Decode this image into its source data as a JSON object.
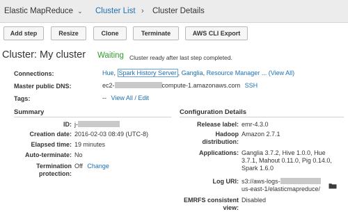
{
  "breadcrumb": {
    "root": "Elastic MapReduce",
    "root_chevron": "⌄",
    "cluster_list": "Cluster List",
    "separator": "›",
    "current": "Cluster Details"
  },
  "toolbar": {
    "add_step": "Add step",
    "resize": "Resize",
    "clone": "Clone",
    "terminate": "Terminate",
    "aws_cli_export": "AWS CLI Export"
  },
  "cluster": {
    "title": "Cluster: My cluster",
    "status": "Waiting",
    "status_message": "Cluster ready after last step completed."
  },
  "overview": {
    "connections_label": "Connections:",
    "connections": {
      "hue": "Hue",
      "comma1": ",",
      "spark_history": "Spark History Server",
      "comma2": ",",
      "ganglia": "Ganglia",
      "comma3": ",",
      "resource_manager": "Resource Manager",
      "ellipsis": "...",
      "view_all": "(View All)"
    },
    "dns_label": "Master public DNS:",
    "dns_prefix": "ec2-",
    "dns_suffix": "compute-1.amazonaws.com",
    "ssh": "SSH",
    "tags_label": "Tags:",
    "tags_dash": "--",
    "tags_view_all": "View All / Edit"
  },
  "summary": {
    "title": "Summary",
    "id_label": "ID:",
    "id_prefix": "j-",
    "creation_label": "Creation date:",
    "creation_value": "2016-02-03 08:49 (UTC-8)",
    "elapsed_label": "Elapsed time:",
    "elapsed_value": "19 minutes",
    "autoterm_label": "Auto-terminate:",
    "autoterm_value": "No",
    "termprot_label_1": "Termination",
    "termprot_label_2": "protection:",
    "termprot_value": "Off",
    "termprot_change": "Change"
  },
  "config": {
    "title": "Configuration Details",
    "release_label": "Release label:",
    "release_value": "emr-4.3.0",
    "hadoop_label_1": "Hadoop",
    "hadoop_label_2": "distribution:",
    "hadoop_value": "Amazon 2.7.1",
    "apps_label": "Applications:",
    "apps_lines": [
      "Ganglia 3.7.2, Hive 1.0.0, Hue",
      "3.7.1, Mahout 0.11.0, Pig 0.14.0,",
      "Spark 1.6.0"
    ],
    "log_label": "Log URI:",
    "log_line1_prefix": "s3://aws-logs-",
    "log_line2": "us-east-1/elasticmapreduce/",
    "emrfs_label_1": "EMRFS consistent",
    "emrfs_label_2": "view:",
    "emrfs_value": "Disabled"
  },
  "icons": {
    "chevron": "chevron-down-icon",
    "folder": "folder-icon"
  },
  "colors": {
    "link": "#1a6fb4",
    "status_green": "#2e9b2e",
    "topbar": "#ececec"
  }
}
